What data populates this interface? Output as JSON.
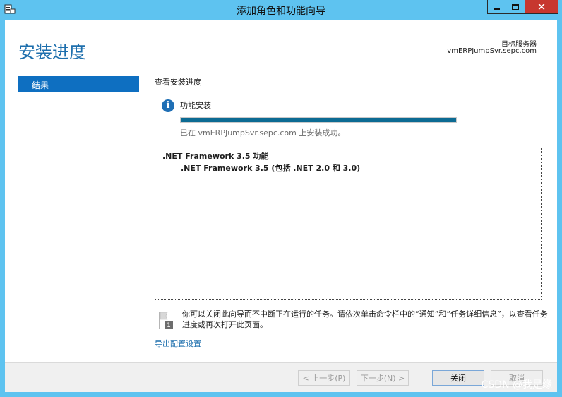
{
  "window": {
    "title": "添加角色和功能向导",
    "close_glyph": "✕"
  },
  "page": {
    "title": "安装进度",
    "server_label": "目标服务器",
    "server_name": "vmERPJumpSvr.sepc.com"
  },
  "nav": {
    "items": [
      {
        "label": "结果",
        "selected": true
      }
    ]
  },
  "progress": {
    "section_heading": "查看安装进度",
    "feature_label": "功能安装",
    "fraction": 1.0,
    "status": "已在 vmERPJumpSvr.sepc.com 上安装成功。"
  },
  "results": {
    "feature": ".NET Framework 3.5 功能",
    "sub_feature": ".NET Framework 3.5 (包括 .NET 2.0 和 3.0)"
  },
  "note": {
    "text": "你可以关闭此向导而不中断正在运行的任务。请依次单击命令栏中的“通知”和“任务详细信息”，以查看任务进度或再次打开此页面。",
    "flag_number": "1"
  },
  "links": {
    "export": "导出配置设置"
  },
  "buttons": {
    "prev": "< 上一步(P)",
    "next": "下一步(N) >",
    "close": "关闭",
    "cancel": "取消"
  },
  "watermark": "CSDN @我是缘",
  "colors": {
    "titlebar": "#5ec3f0",
    "accent": "#1e6fad",
    "nav_selected": "#0e6fc1",
    "progress": "#0c6b93",
    "close_button": "#c7372f"
  }
}
